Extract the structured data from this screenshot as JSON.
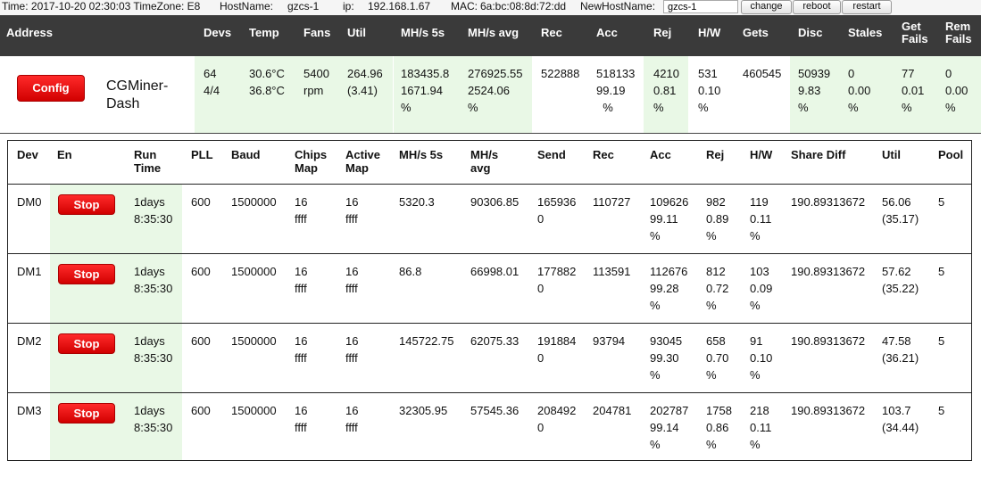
{
  "topbar": {
    "time": "Time: 2017-10-20 02:30:03 TimeZone: E8",
    "hostname_label": "HostName:",
    "hostname": "gzcs-1",
    "ip_label": "ip:",
    "ip": "192.168.1.67",
    "mac_label": "MAC:",
    "mac": "6a:bc:08:8d:72:dd",
    "newhost_label": "NewHostName:",
    "newhost_value": "gzcs-1",
    "change_label": "change",
    "reboot_label": "reboot",
    "restart_label": "restart"
  },
  "summary": {
    "headers": {
      "address": "Address",
      "devs": "Devs",
      "temp": "Temp",
      "fans": "Fans",
      "util": "Util",
      "mhs5s": "MH/s 5s",
      "mhsavg": "MH/s avg",
      "rec": "Rec",
      "acc": "Acc",
      "rej": "Rej",
      "hw": "H/W",
      "gets": "Gets",
      "disc": "Disc",
      "stales": "Stales",
      "getfails1": "Get",
      "getfails2": "Fails",
      "remfails1": "Rem",
      "remfails2": "Fails"
    },
    "config_label": "Config",
    "brand1": "CGMiner-",
    "brand2": "Dash",
    "devs1": "64",
    "devs2": "4/4",
    "temp1": "30.6°C",
    "temp2": "36.8°C",
    "fans1": "5400",
    "fans2": "rpm",
    "util1": "264.96",
    "util2": "(3.41)",
    "mhs5s1": "183435.8",
    "mhs5s2": "1671.94",
    "mhs5s3": "%",
    "mhsavg1": "276925.55",
    "mhsavg2": "2524.06",
    "mhsavg3": "%",
    "rec": "522888",
    "acc1": "518133",
    "acc2": "99.19",
    "acc3": "%",
    "rej1": "4210",
    "rej2": "0.81",
    "rej3": "%",
    "hw1": "531",
    "hw2": "0.10",
    "hw3": "%",
    "gets": "460545",
    "disc1": "50939",
    "disc2": "9.83",
    "disc3": "%",
    "stales1": "0",
    "stales2": "0.00",
    "stales3": "%",
    "getfails1": "77",
    "getfails2": "0.01",
    "getfails3": "%",
    "remfails1": "0",
    "remfails2": "0.00",
    "remfails3": "%"
  },
  "devices": {
    "headers": {
      "dev": "Dev",
      "en": "En",
      "runtime1": "Run",
      "runtime2": "Time",
      "pll": "PLL",
      "baud": "Baud",
      "chips1": "Chips",
      "chips2": "Map",
      "active1": "Active",
      "active2": "Map",
      "mhs5s": "MH/s 5s",
      "mhsavg1": "MH/s",
      "mhsavg2": "avg",
      "send": "Send",
      "rec": "Rec",
      "acc": "Acc",
      "rej": "Rej",
      "hw": "H/W",
      "sharediff": "Share Diff",
      "util": "Util",
      "pool": "Pool"
    },
    "rows": [
      {
        "dev": "DM0",
        "en": "Stop",
        "rt1": "1days",
        "rt2": "8:35:30",
        "pll": "600",
        "baud": "1500000",
        "chips1": "16",
        "chips2": "ffff",
        "active1": "16",
        "active2": "ffff",
        "mhs5s": "5320.3",
        "mhsavg": "90306.85",
        "send1": "165936",
        "send2": "0",
        "rec": "110727",
        "acc1": "109626",
        "acc2": "99.11",
        "acc3": "%",
        "rej1": "982",
        "rej2": "0.89",
        "rej3": "%",
        "hw1": "119",
        "hw2": "0.11",
        "hw3": "%",
        "sharediff": "190.89313672",
        "util1": "56.06",
        "util2": "(35.17)",
        "pool": "5"
      },
      {
        "dev": "DM1",
        "en": "Stop",
        "rt1": "1days",
        "rt2": "8:35:30",
        "pll": "600",
        "baud": "1500000",
        "chips1": "16",
        "chips2": "ffff",
        "active1": "16",
        "active2": "ffff",
        "mhs5s": "86.8",
        "mhsavg": "66998.01",
        "send1": "177882",
        "send2": "0",
        "rec": "113591",
        "acc1": "112676",
        "acc2": "99.28",
        "acc3": "%",
        "rej1": "812",
        "rej2": "0.72",
        "rej3": "%",
        "hw1": "103",
        "hw2": "0.09",
        "hw3": "%",
        "sharediff": "190.89313672",
        "util1": "57.62",
        "util2": "(35.22)",
        "pool": "5"
      },
      {
        "dev": "DM2",
        "en": "Stop",
        "rt1": "1days",
        "rt2": "8:35:30",
        "pll": "600",
        "baud": "1500000",
        "chips1": "16",
        "chips2": "ffff",
        "active1": "16",
        "active2": "ffff",
        "mhs5s": "145722.75",
        "mhsavg": "62075.33",
        "send1": "191884",
        "send2": "0",
        "rec": "93794",
        "acc1": "93045",
        "acc2": "99.30",
        "acc3": "%",
        "rej1": "658",
        "rej2": "0.70",
        "rej3": "%",
        "hw1": "91",
        "hw2": "0.10",
        "hw3": "%",
        "sharediff": "190.89313672",
        "util1": "47.58",
        "util2": "(36.21)",
        "pool": "5"
      },
      {
        "dev": "DM3",
        "en": "Stop",
        "rt1": "1days",
        "rt2": "8:35:30",
        "pll": "600",
        "baud": "1500000",
        "chips1": "16",
        "chips2": "ffff",
        "active1": "16",
        "active2": "ffff",
        "mhs5s": "32305.95",
        "mhsavg": "57545.36",
        "send1": "208492",
        "send2": "0",
        "rec": "204781",
        "acc1": "202787",
        "acc2": "99.14",
        "acc3": "%",
        "rej1": "1758",
        "rej2": "0.86",
        "rej3": "%",
        "hw1": "218",
        "hw2": "0.11",
        "hw3": "%",
        "sharediff": "190.89313672",
        "util1": "103.7",
        "util2": "(34.44)",
        "pool": "5"
      }
    ]
  }
}
